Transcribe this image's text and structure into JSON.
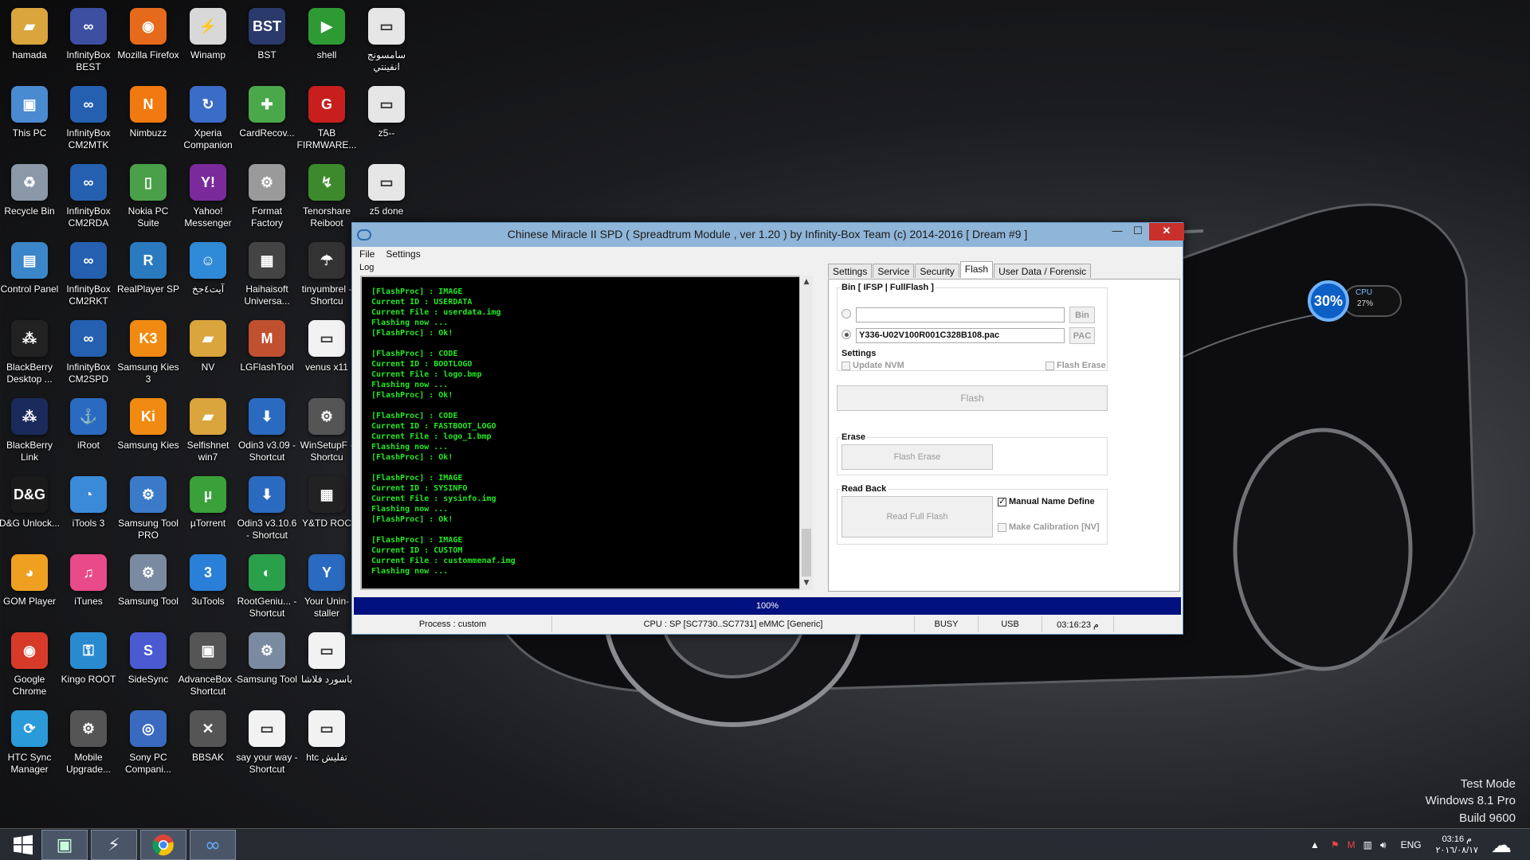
{
  "desktop": {
    "icons": [
      {
        "label": "hamada",
        "icon": "folder-icon",
        "color": "#d9a53c",
        "glyph": "▰"
      },
      {
        "label": "InfinityBox BEST",
        "icon": "infinitybox-best-icon",
        "color": "#3c4fa0",
        "glyph": "∞"
      },
      {
        "label": "Mozilla Firefox",
        "icon": "firefox-icon",
        "color": "#e66a1c",
        "glyph": "◉"
      },
      {
        "label": "Winamp",
        "icon": "winamp-icon",
        "color": "#d8d8d8",
        "glyph": "⚡"
      },
      {
        "label": "BST",
        "icon": "bst-icon",
        "color": "#2a3a6a",
        "glyph": "BST"
      },
      {
        "label": "shell",
        "icon": "shell-icon",
        "color": "#2e9a34",
        "glyph": "▶"
      },
      {
        "label": "سامسونج انفينتي",
        "icon": "samsung-infinity-icon",
        "color": "#e6e6e6",
        "glyph": "▭"
      },
      {
        "label": "This PC",
        "icon": "this-pc-icon",
        "color": "#4a8ad0",
        "glyph": "▣"
      },
      {
        "label": "InfinityBox CM2MTK",
        "icon": "infinitybox-cm2mtk-icon",
        "color": "#2560b0",
        "glyph": "∞"
      },
      {
        "label": "Nimbuzz",
        "icon": "nimbuzz-icon",
        "color": "#f07a10",
        "glyph": "N"
      },
      {
        "label": "Xperia Companion",
        "icon": "xperia-companion-icon",
        "color": "#3b6cc7",
        "glyph": "↻"
      },
      {
        "label": "CardRecov...",
        "icon": "cardrecovery-icon",
        "color": "#4aa84a",
        "glyph": "✚"
      },
      {
        "label": "TAB FIRMWARE...",
        "icon": "tab-firmware-icon",
        "color": "#c81e1e",
        "glyph": "G"
      },
      {
        "label": "z5--",
        "icon": "file-z5-icon",
        "color": "#e6e6e6",
        "glyph": "▭"
      },
      {
        "label": "Recycle Bin",
        "icon": "recycle-bin-icon",
        "color": "#8a98a8",
        "glyph": "♻"
      },
      {
        "label": "InfinityBox CM2RDA",
        "icon": "infinitybox-cm2rda-icon",
        "color": "#2560b0",
        "glyph": "∞"
      },
      {
        "label": "Nokia PC Suite",
        "icon": "nokia-pc-suite-icon",
        "color": "#4aa048",
        "glyph": "▯"
      },
      {
        "label": "Yahoo! Messenger",
        "icon": "yahoo-messenger-icon",
        "color": "#7b2a9c",
        "glyph": "Y!"
      },
      {
        "label": "Format Factory",
        "icon": "format-factory-icon",
        "color": "#9a9a9a",
        "glyph": "⚙"
      },
      {
        "label": "Tenorshare Reiboot",
        "icon": "tenorshare-reiboot-icon",
        "color": "#3c8a2c",
        "glyph": "↯"
      },
      {
        "label": "z5 done",
        "icon": "file-z5-done-icon",
        "color": "#e6e6e6",
        "glyph": "▭"
      },
      {
        "label": "Control Panel",
        "icon": "control-panel-icon",
        "color": "#3b86c8",
        "glyph": "▤"
      },
      {
        "label": "InfinityBox CM2RKT",
        "icon": "infinitybox-cm2rkt-icon",
        "color": "#2560b0",
        "glyph": "∞"
      },
      {
        "label": "RealPlayer SP",
        "icon": "realplayer-icon",
        "color": "#2a7ac0",
        "glyph": "R"
      },
      {
        "label": "آيت٤جخ",
        "icon": "android-app-icon",
        "color": "#2f8ad8",
        "glyph": "☺"
      },
      {
        "label": "Haihaisoft Universa...",
        "icon": "haihaisoft-icon",
        "color": "#444444",
        "glyph": "▦"
      },
      {
        "label": "tinyumbrel - Shortcu",
        "icon": "tinyumbrella-icon",
        "color": "#333333",
        "glyph": "☂"
      },
      {
        "label": "BlackBerry Desktop ...",
        "icon": "blackberry-desktop-icon",
        "color": "#222222",
        "glyph": "⁂"
      },
      {
        "label": "InfinityBox CM2SPD",
        "icon": "infinitybox-cm2spd-icon",
        "color": "#2560b0",
        "glyph": "∞"
      },
      {
        "label": "Samsung Kies 3",
        "icon": "samsung-kies3-icon",
        "color": "#f08a10",
        "glyph": "K3"
      },
      {
        "label": "NV",
        "icon": "nv-folder-icon",
        "color": "#d9a53c",
        "glyph": "▰"
      },
      {
        "label": "LGFlashTool",
        "icon": "lgflashtool-icon",
        "color": "#c05030",
        "glyph": "M"
      },
      {
        "label": "venus x11",
        "icon": "venus-file-icon",
        "color": "#f2f2f2",
        "glyph": "▭"
      },
      {
        "label": "BlackBerry Link",
        "icon": "blackberry-link-icon",
        "color": "#1a2a5a",
        "glyph": "⁂"
      },
      {
        "label": "iRoot",
        "icon": "iroot-icon",
        "color": "#2a6ac0",
        "glyph": "⚓"
      },
      {
        "label": "Samsung Kies",
        "icon": "samsung-kies-icon",
        "color": "#f08a10",
        "glyph": "Ki"
      },
      {
        "label": "Selfishnet win7",
        "icon": "selfishnet-folder-icon",
        "color": "#d9a53c",
        "glyph": "▰"
      },
      {
        "label": "Odin3 v3.09 - Shortcut",
        "icon": "odin-309-icon",
        "color": "#2a6ac0",
        "glyph": "⬇"
      },
      {
        "label": "WinSetupF - Shortcu",
        "icon": "winsetup-icon",
        "color": "#555555",
        "glyph": "⚙"
      },
      {
        "label": "D&G Unlock...",
        "icon": "dg-unlock-icon",
        "color": "#1a1a1a",
        "glyph": "D&G"
      },
      {
        "label": "iTools 3",
        "icon": "itools-icon",
        "color": "#3a8ad8",
        "glyph": "◔"
      },
      {
        "label": "Samsung Tool PRO",
        "icon": "samsung-tool-pro-icon",
        "color": "#3a7ac8",
        "glyph": "⚙"
      },
      {
        "label": "µTorrent",
        "icon": "utorrent-icon",
        "color": "#3aa03a",
        "glyph": "µ"
      },
      {
        "label": "Odin3 v3.10.6 - Shortcut",
        "icon": "odin-3106-icon",
        "color": "#2a6ac0",
        "glyph": "⬇"
      },
      {
        "label": "Y&TD ROC",
        "icon": "ytd-roc-icon",
        "color": "#222222",
        "glyph": "▦"
      },
      {
        "label": "GOM Player",
        "icon": "gom-player-icon",
        "color": "#f0a020",
        "glyph": "◕"
      },
      {
        "label": "iTunes",
        "icon": "itunes-icon",
        "color": "#e84a8a",
        "glyph": "♫"
      },
      {
        "label": "Samsung Tool",
        "icon": "samsung-tool-icon",
        "color": "#7a8aa0",
        "glyph": "⚙"
      },
      {
        "label": "3uTools",
        "icon": "3utools-icon",
        "color": "#2a80d8",
        "glyph": "3"
      },
      {
        "label": "RootGeniu... - Shortcut",
        "icon": "rootgenius-icon",
        "color": "#2aa04a",
        "glyph": "◐"
      },
      {
        "label": "Your Unin-staller",
        "icon": "your-uninstaller-icon",
        "color": "#2a6ac0",
        "glyph": "Y"
      },
      {
        "label": "Google Chrome",
        "icon": "chrome-icon",
        "color": "#d83a2a",
        "glyph": "◉"
      },
      {
        "label": "Kingo ROOT",
        "icon": "kingo-root-icon",
        "color": "#2a8ad0",
        "glyph": "⚿"
      },
      {
        "label": "SideSync",
        "icon": "sidesync-icon",
        "color": "#4a5ad0",
        "glyph": "S"
      },
      {
        "label": "AdvanceBox - Shortcut",
        "icon": "advancebox-icon",
        "color": "#555555",
        "glyph": "▣"
      },
      {
        "label": "Samsung Tool",
        "icon": "samsung-tool-2-icon",
        "color": "#7a8aa0",
        "glyph": "⚙"
      },
      {
        "label": "باسورد فلاشا",
        "icon": "password-file-icon",
        "color": "#f2f2f2",
        "glyph": "▭"
      },
      {
        "label": "HTC Sync Manager",
        "icon": "htc-sync-icon",
        "color": "#2a9ad8",
        "glyph": "⟳"
      },
      {
        "label": "Mobile Upgrade...",
        "icon": "mobile-upgrade-icon",
        "color": "#555555",
        "glyph": "⚙"
      },
      {
        "label": "Sony PC Compani...",
        "icon": "sony-pc-companion-icon",
        "color": "#3a6ac0",
        "glyph": "◎"
      },
      {
        "label": "BBSAK",
        "icon": "bbsak-icon",
        "color": "#555555",
        "glyph": "✕"
      },
      {
        "label": "say your way - Shortcut",
        "icon": "say-your-way-icon",
        "color": "#f2f2f2",
        "glyph": "▭"
      },
      {
        "label": "htc تفليش",
        "icon": "htc-flash-file-icon",
        "color": "#f2f2f2",
        "glyph": "▭"
      }
    ]
  },
  "window": {
    "title": "Chinese Miracle II SPD ( Spreadtrum Module , ver 1.20 ) by Infinity-Box Team (c) 2014-2016 [ Dream #9 ]",
    "min": "—",
    "max": "☐",
    "close": "✕",
    "menu": [
      "File",
      "Settings"
    ],
    "log_label": "Log",
    "log_lines": [
      "[FlashProc] : IMAGE",
      "Current ID : USERDATA",
      "Current File : userdata.img",
      "Flashing now ...",
      "[FlashProc] : Ok!",
      "",
      "[FlashProc] : CODE",
      "Current ID : BOOTLOGO",
      "Current File : logo.bmp",
      "Flashing now ...",
      "[FlashProc] : Ok!",
      "",
      "[FlashProc] : CODE",
      "Current ID : FASTBOOT_LOGO",
      "Current File : logo_1.bmp",
      "Flashing now ...",
      "[FlashProc] : Ok!",
      "",
      "[FlashProc] : IMAGE",
      "Current ID : SYSINFO",
      "Current File : sysinfo.img",
      "Flashing now ...",
      "[FlashProc] : Ok!",
      "",
      "[FlashProc] : IMAGE",
      "Current ID : CUSTOM",
      "Current File : custommenaf.img",
      "Flashing now ..."
    ],
    "tabs": [
      "Settings",
      "Service",
      "Security",
      "Flash",
      "User Data / Forensic"
    ],
    "active_tab": "Flash",
    "flash": {
      "bin_group": "Bin  [ IFSP | FullFlash ]",
      "bin_path": "",
      "bin_button": "Bin",
      "pac_path": "Y336-U02V100R001C328B108.pac",
      "pac_button": "PAC",
      "selected_source": "PAC",
      "settings_label": "Settings",
      "update_nvm": "Update NVM",
      "update_nvm_checked": false,
      "flash_erase_chk": "Flash Erase",
      "flash_erase_checked": false,
      "flash_button": "Flash",
      "erase_label": "Erase",
      "flash_erase_button": "Flash Erase",
      "readback_label": "Read Back",
      "read_full_flash_button": "Read Full Flash",
      "manual_name": "Manual Name Define",
      "manual_name_checked": true,
      "make_calibration": "Make Calibration [NV]",
      "make_calibration_checked": false
    },
    "progress_text": "100%",
    "progress_value": 1.0,
    "status": {
      "process": "Process : custom",
      "cpu": "CPU : SP [SC7730..SC7731] eMMC [Generic]",
      "state": "BUSY",
      "conn": "USB",
      "time": "03:16:23 م"
    }
  },
  "gadget": {
    "cpu_percent": "30%",
    "label": "CPU",
    "value": "27%"
  },
  "watermark": {
    "line1": "Test Mode",
    "line2": "Windows 8.1 Pro",
    "line3": "Build 9600"
  },
  "taskbar": {
    "start": "start-icon",
    "apps": [
      "cmd-tool-icon",
      "winamp-taskbar-icon",
      "chrome-taskbar-icon",
      "infinitybox-taskbar-icon"
    ],
    "lang": "ENG",
    "time": "03:16 م",
    "date": "٢٠١٦/٠٨/١٧"
  },
  "colors": {
    "log_green": "#22e822",
    "progress_blue": "#00107f",
    "title_bar": "#8fb5d8",
    "close_red": "#c9302c"
  }
}
